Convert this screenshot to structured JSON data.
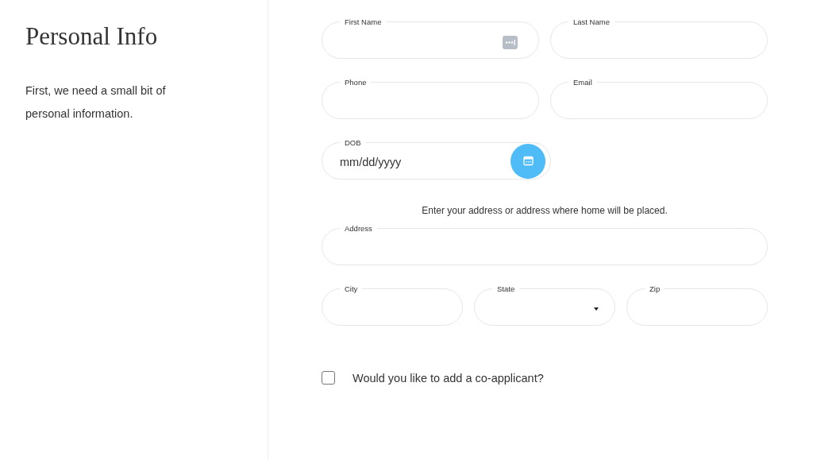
{
  "intro": {
    "title": "Personal Info",
    "text": "First, we need a small bit of personal information."
  },
  "rows": [
    {
      "fields": [
        {
          "label": "First Name",
          "kind": "autofill"
        },
        {
          "label": "Last Name",
          "kind": "text"
        }
      ]
    },
    {
      "fields": [
        {
          "label": "Phone",
          "kind": "text"
        },
        {
          "label": "Email",
          "kind": "text"
        }
      ]
    },
    {
      "fields": [
        {
          "label": "DOB",
          "kind": "date",
          "placeholder": "mm/dd/yyyy"
        },
        {
          "kind": "spacer"
        }
      ]
    },
    {
      "note": "Enter your address or address where home will be placed."
    },
    {
      "fields": [
        {
          "label": "Address",
          "kind": "text"
        }
      ]
    },
    {
      "fields": [
        {
          "label": "City",
          "kind": "text"
        },
        {
          "label": "State",
          "kind": "select"
        },
        {
          "label": "Zip",
          "kind": "text"
        }
      ]
    }
  ],
  "co_applicant": {
    "label": "Would you like to add a co-applicant?",
    "checked": false
  }
}
